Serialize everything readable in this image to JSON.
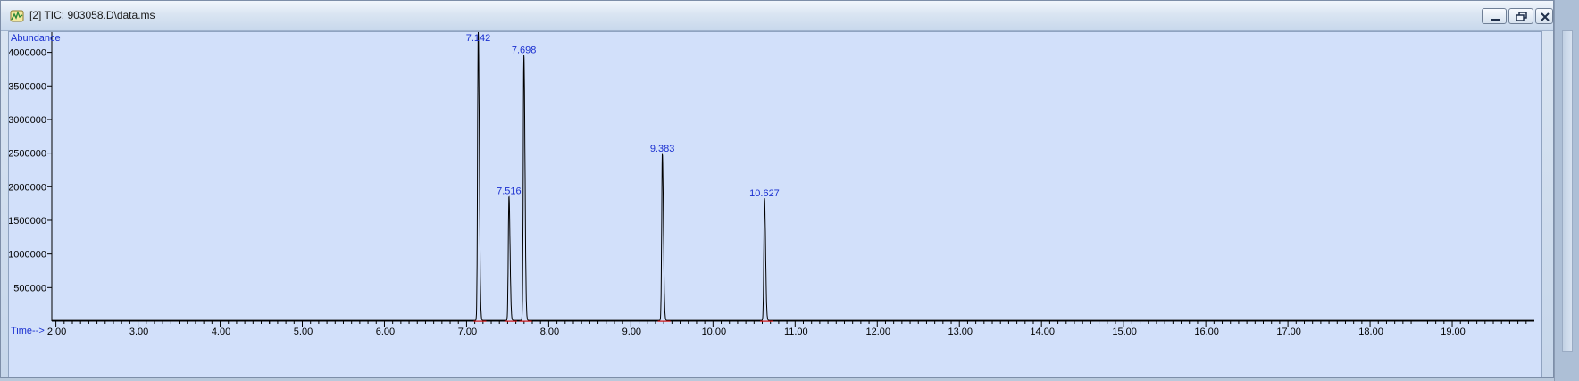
{
  "window": {
    "title": "[2] TIC: 903058.D\\data.ms",
    "icon": "chromatogram-app-icon",
    "controls": {
      "minimize": "minimize-icon",
      "restore": "restore-icon",
      "close": "close-icon"
    }
  },
  "chart_data": {
    "type": "line",
    "ylabel": "Abundance",
    "xlabel": "Time-->",
    "xlim": [
      1.95,
      20.0
    ],
    "ylim": [
      0,
      4300000
    ],
    "x_ticks": [
      2.0,
      3.0,
      4.0,
      5.0,
      6.0,
      7.0,
      8.0,
      9.0,
      10.0,
      11.0,
      12.0,
      13.0,
      14.0,
      15.0,
      16.0,
      17.0,
      18.0,
      19.0
    ],
    "x_tick_labels": [
      "2.00",
      "3.00",
      "4.00",
      "5.00",
      "6.00",
      "7.00",
      "8.00",
      "9.00",
      "10.00",
      "11.00",
      "12.00",
      "13.00",
      "14.00",
      "15.00",
      "16.00",
      "17.00",
      "18.00",
      "19.00"
    ],
    "y_ticks": [
      500000,
      1000000,
      1500000,
      2000000,
      2500000,
      3000000,
      3500000,
      4000000
    ],
    "y_tick_labels": [
      "500000",
      "1000000",
      "1500000",
      "2000000",
      "2500000",
      "3000000",
      "3500000",
      "4000000"
    ],
    "grid": false,
    "line_color": "#000000",
    "label_color": "#1a2fd0",
    "baseline_marker_color": "#d01010",
    "peaks": [
      {
        "label": "7.142",
        "rt": 7.142,
        "abundance": 4300000
      },
      {
        "label": "7.516",
        "rt": 7.516,
        "abundance": 1850000
      },
      {
        "label": "7.698",
        "rt": 7.698,
        "abundance": 3950000
      },
      {
        "label": "9.383",
        "rt": 9.383,
        "abundance": 2480000
      },
      {
        "label": "10.627",
        "rt": 10.627,
        "abundance": 1820000
      }
    ]
  }
}
